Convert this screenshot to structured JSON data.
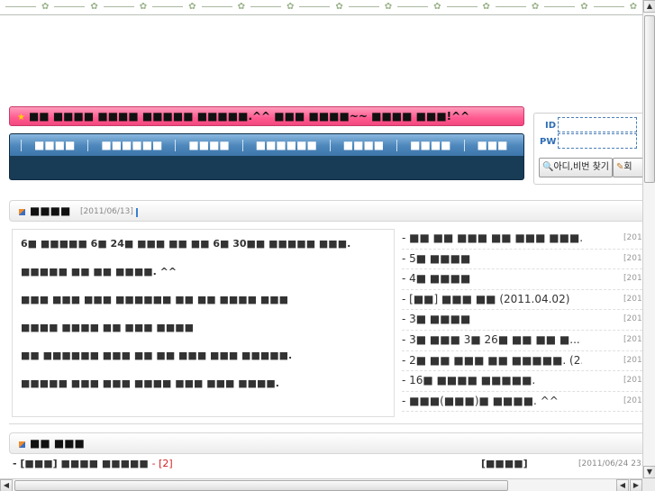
{
  "marquee": {
    "text": "■■ ■■■■ ■■■■ ■■■■■ ■■■■■.^^ ■■■ ■■■■~~ ■■■■ ■■■!^^"
  },
  "nav": {
    "items": [
      "■■■■",
      "■■■■■■",
      "■■■■",
      "■■■■■■",
      "■■■■",
      "■■■■",
      "■■■"
    ]
  },
  "login": {
    "id_label": "ID",
    "pw_label": "PW",
    "find_button": "아디,비번 찾기",
    "join_button": "회"
  },
  "notice": {
    "title": "■■■■",
    "date": "[2011/06/13]",
    "lines": [
      "6■ ■■■■■ 6■ 24■ ■■■ ■■ ■■ 6■ 30■■ ■■■■■ ■■■.",
      "■■■■■ ■■ ■■ ■■■■. ^^",
      "■■■ ■■■ ■■■ ■■■■■■ ■■ ■■ ■■■■ ■■■",
      "■■■■ ■■■■ ■■ ■■■ ■■■■",
      "■■ ■■■■■■ ■■■ ■■ ■■ ■■■ ■■■ ■■■■■.",
      "■■■■■ ■■■ ■■■ ■■■■ ■■■ ■■■ ■■■■."
    ]
  },
  "recent": {
    "items": [
      {
        "text": "- ■■ ■■ ■■■ ■■ ■■■ ■■■...",
        "date": "[201"
      },
      {
        "text": "- 5■ ■■■■",
        "date": "[201"
      },
      {
        "text": "- 4■ ■■■■",
        "date": "[201"
      },
      {
        "text": "- [■■] ■■■ ■■ (2011.04.02)",
        "date": "[201"
      },
      {
        "text": "- 3■ ■■■■",
        "date": "[201"
      },
      {
        "text": "- 3■ ■■■ 3■ 26■ ■■ ■■ ■...",
        "date": "[201"
      },
      {
        "text": "- 2■ ■■ ■■■ ■■ ■■■■■. (2...",
        "date": "[201"
      },
      {
        "text": "- 16■ ■■■■ ■■■■■.",
        "date": "[201"
      },
      {
        "text": "- ■■■(■■■)■ ■■■■. ^^",
        "date": "[201"
      }
    ]
  },
  "board": {
    "title": "■■ ■■■",
    "row": {
      "text": "- [■■■] ■■■■ ■■■■■ ",
      "count": "- [2]",
      "category": "[■■■■]",
      "date": "[2011/06/24 23:"
    }
  },
  "colors": {
    "marquee": "#ff5a90",
    "nav": "#3d76aa",
    "nav_dark": "#183c56",
    "accent": "#2f6db5"
  }
}
